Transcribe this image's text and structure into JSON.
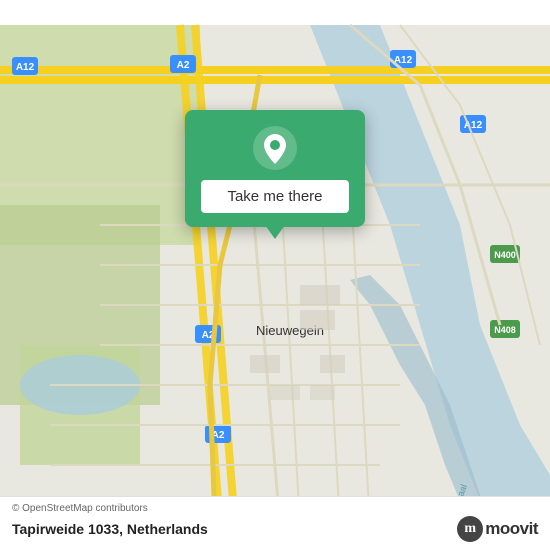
{
  "map": {
    "alt": "OpenStreetMap of Nieuwegein, Netherlands",
    "center_lat": 52.03,
    "center_lng": 5.09
  },
  "popup": {
    "button_label": "Take me there",
    "pin_color": "#ffffff"
  },
  "bottom_bar": {
    "copyright": "© OpenStreetMap contributors",
    "address": "Tapirweide 1033, Netherlands",
    "logo_letter": "m",
    "logo_text": "moovit"
  }
}
